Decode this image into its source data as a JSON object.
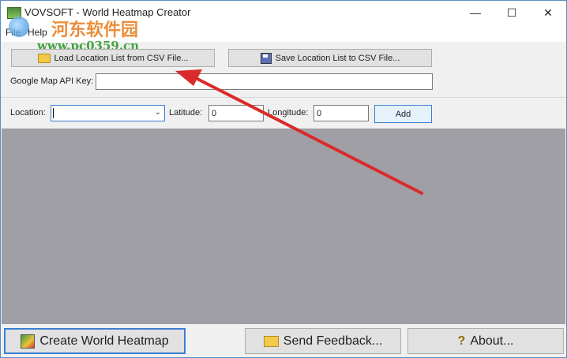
{
  "window": {
    "title": "VOVSOFT - World Heatmap Creator",
    "minimize_glyph": "—",
    "maximize_glyph": "☐",
    "close_glyph": "✕"
  },
  "menu": {
    "file": "File",
    "help": "Help"
  },
  "watermark": {
    "title": "河东软件园",
    "url": "www.pc0359.cn"
  },
  "toolbar": {
    "load_label": "Load Location List from CSV File...",
    "save_label": "Save Location List to CSV File..."
  },
  "api_key": {
    "label": "Google Map API Key:",
    "value": ""
  },
  "location_row": {
    "location_label": "Location:",
    "location_value": "",
    "latitude_label": "Latitude:",
    "latitude_value": "0",
    "longitude_label": "Longitude:",
    "longitude_value": "0",
    "add_label": "Add"
  },
  "bottom": {
    "create_label": "Create World Heatmap",
    "feedback_label": "Send Feedback...",
    "about_label": "About..."
  },
  "icons": {
    "load": "folder-icon",
    "save": "floppy-disk-icon",
    "create": "heatmap-icon",
    "feedback": "envelope-icon",
    "about": "help-icon"
  },
  "colors": {
    "map_background": "#a09fa5",
    "annotation_arrow": "#d92b2b",
    "focus_border": "#3c7fd1"
  }
}
